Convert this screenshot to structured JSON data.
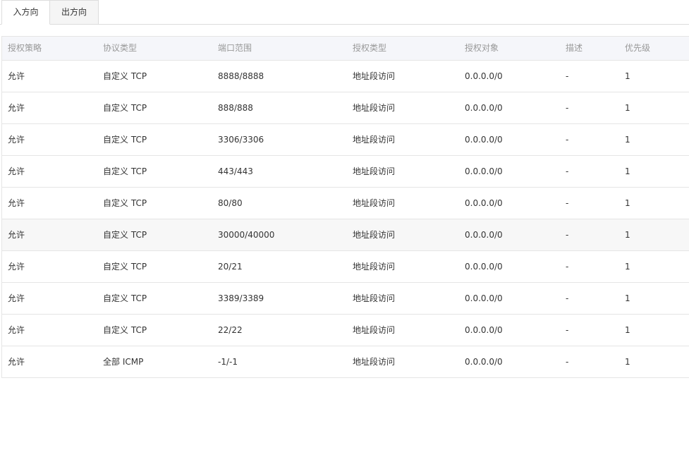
{
  "tabs": [
    {
      "label": "入方向",
      "active": true
    },
    {
      "label": "出方向",
      "active": false
    }
  ],
  "table": {
    "columns": [
      "授权策略",
      "协议类型",
      "端口范围",
      "授权类型",
      "授权对象",
      "描述",
      "优先级"
    ],
    "rows": [
      [
        "允许",
        "自定义 TCP",
        "8888/8888",
        "地址段访问",
        "0.0.0.0/0",
        "-",
        "1"
      ],
      [
        "允许",
        "自定义 TCP",
        "888/888",
        "地址段访问",
        "0.0.0.0/0",
        "-",
        "1"
      ],
      [
        "允许",
        "自定义 TCP",
        "3306/3306",
        "地址段访问",
        "0.0.0.0/0",
        "-",
        "1"
      ],
      [
        "允许",
        "自定义 TCP",
        "443/443",
        "地址段访问",
        "0.0.0.0/0",
        "-",
        "1"
      ],
      [
        "允许",
        "自定义 TCP",
        "80/80",
        "地址段访问",
        "0.0.0.0/0",
        "-",
        "1"
      ],
      [
        "允许",
        "自定义 TCP",
        "30000/40000",
        "地址段访问",
        "0.0.0.0/0",
        "-",
        "1"
      ],
      [
        "允许",
        "自定义 TCP",
        "20/21",
        "地址段访问",
        "0.0.0.0/0",
        "-",
        "1"
      ],
      [
        "允许",
        "自定义 TCP",
        "3389/3389",
        "地址段访问",
        "0.0.0.0/0",
        "-",
        "1"
      ],
      [
        "允许",
        "自定义 TCP",
        "22/22",
        "地址段访问",
        "0.0.0.0/0",
        "-",
        "1"
      ],
      [
        "允许",
        "全部 ICMP",
        "-1/-1",
        "地址段访问",
        "0.0.0.0/0",
        "-",
        "1"
      ]
    ],
    "highlighted_row_index": 5
  },
  "colors": {
    "header_bg": "#f5f6fa",
    "header_text": "#999999",
    "border": "#e5e5e5",
    "row_hover_bg": "#f7f7f7",
    "inactive_tab_bg": "#f5f5f5"
  }
}
